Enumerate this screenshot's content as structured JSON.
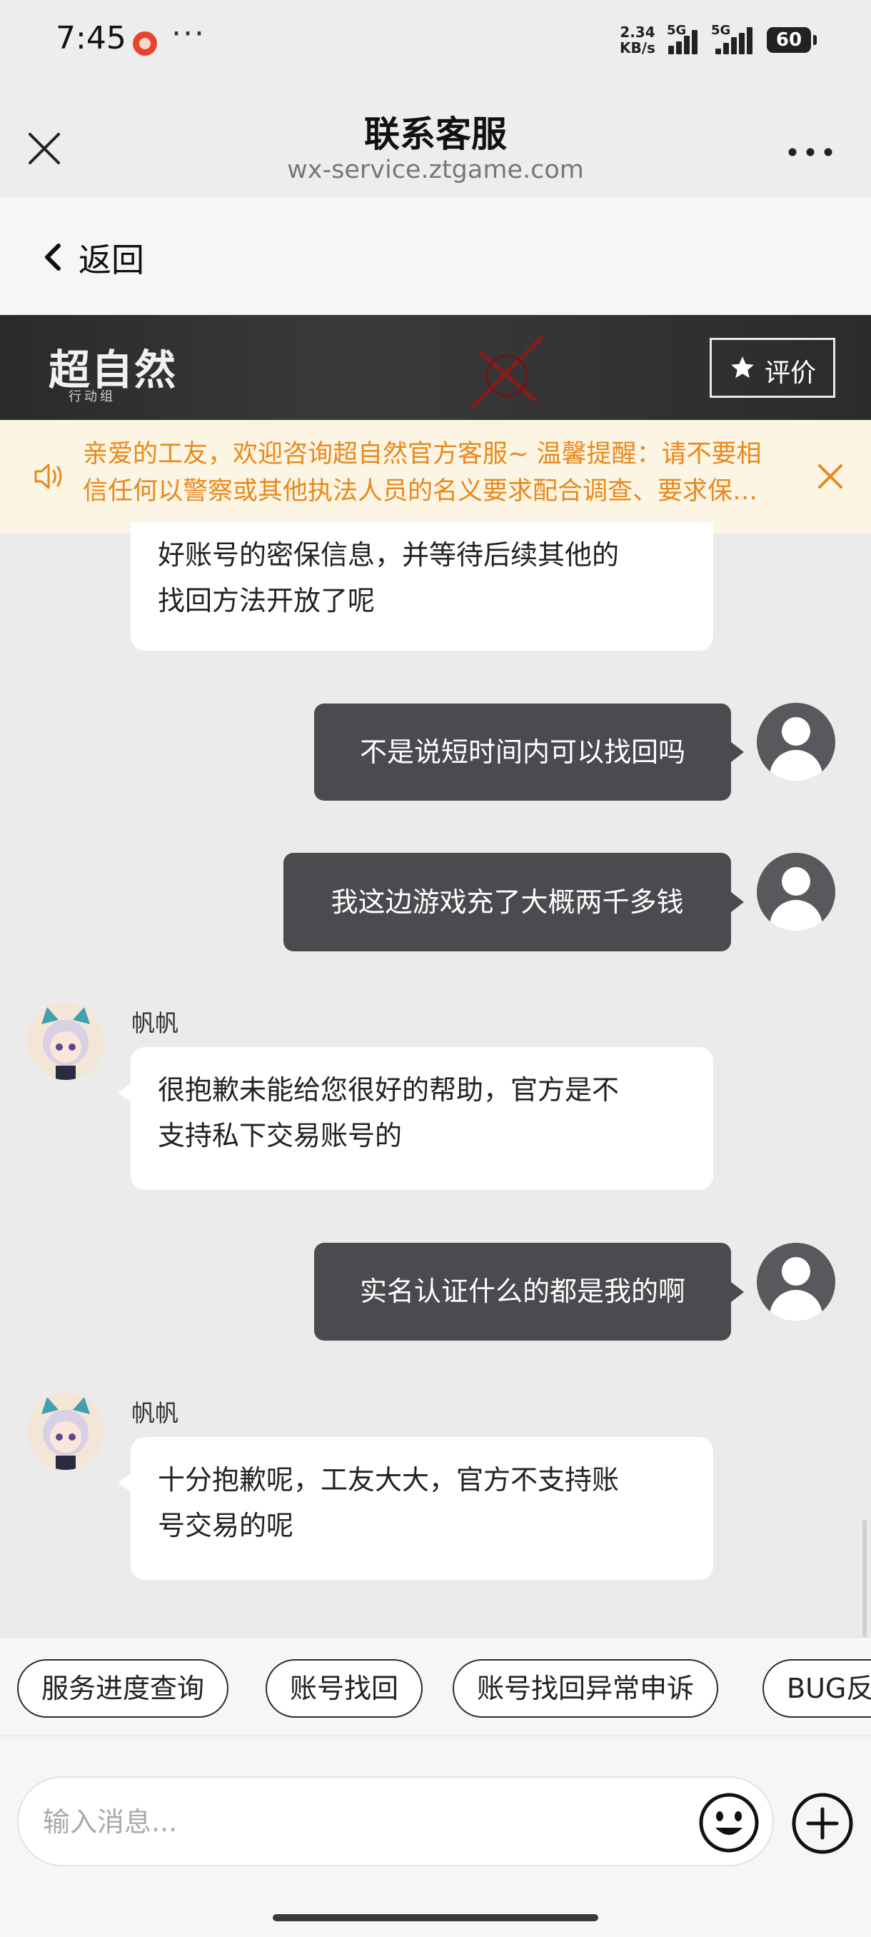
{
  "status_bar": {
    "time": "7:45",
    "more": "···",
    "net_speed": "2.34",
    "net_unit": "KB/s",
    "sim1": "5G",
    "sim2": "5G",
    "battery": "60"
  },
  "header": {
    "title": "联系客服",
    "subtitle": "wx-service.ztgame.com"
  },
  "back": {
    "label": "返回"
  },
  "banner": {
    "logo_text": "超自然",
    "logo_sub": "行动组",
    "rate_label": "评价"
  },
  "notice": {
    "line1": "亲爱的工友，欢迎咨询超自然官方客服~ 温馨提醒：请不要相",
    "line2": "信任何以警察或其他执法人员的名义要求配合调查、要求保…"
  },
  "messages": [
    {
      "from": "agent",
      "lines": [
        "好账号的密保信息，并等待后续其他的",
        "找回方法开放了呢"
      ]
    },
    {
      "from": "user",
      "text": "不是说短时间内可以找回吗"
    },
    {
      "from": "user",
      "text": "我这边游戏充了大概两千多钱"
    },
    {
      "from": "agent",
      "name": "帆帆",
      "lines": [
        "很抱歉未能给您很好的帮助，官方是不",
        "支持私下交易账号的"
      ]
    },
    {
      "from": "user",
      "text": "实名认证什么的都是我的啊"
    },
    {
      "from": "agent",
      "name": "帆帆",
      "lines": [
        "十分抱歉呢，工友大大，官方不支持账",
        "号交易的呢"
      ]
    }
  ],
  "quick_replies": [
    "服务进度查询",
    "账号找回",
    "账号找回异常申诉",
    "BUG反馈"
  ],
  "composer": {
    "placeholder": "输入消息..."
  },
  "colors": {
    "notice_text": "#e8891c",
    "notice_bg": "#fcf5e3",
    "user_bubble": "#4a4a4f",
    "agent_bubble": "#ffffff"
  }
}
